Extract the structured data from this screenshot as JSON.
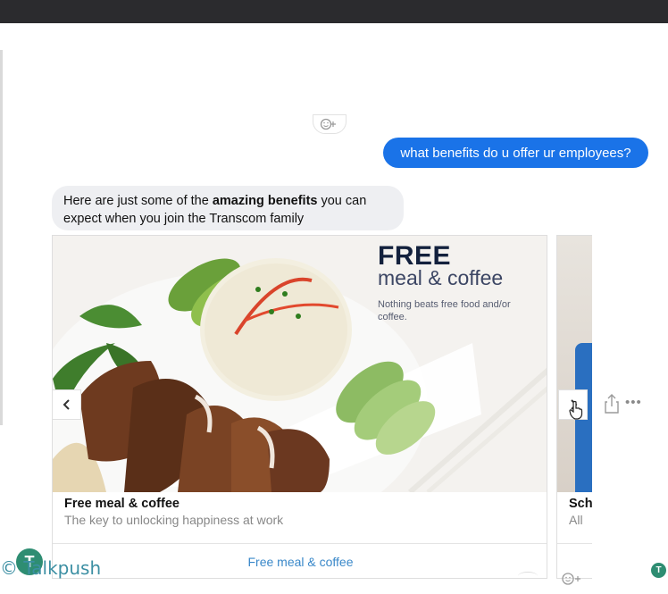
{
  "chat": {
    "outgoing_message": "what benefits do u offer ur employees?",
    "incoming_parts": {
      "before": "Here are just some of the ",
      "bold": "amazing benefits",
      "after": " you can expect when you join the Transcom family"
    }
  },
  "carousel": {
    "cards": [
      {
        "promo_big": "FREE",
        "promo_sub": "meal & coffee",
        "promo_small": "Nothing beats free food and/or coffee.",
        "title": "Free meal & coffee",
        "subtitle": "The key to unlocking happiness at work",
        "button_label": "Free meal & coffee"
      },
      {
        "title": "Sch",
        "subtitle": "All"
      }
    ],
    "prev_icon": "chevron-left-icon",
    "next_icon": "chevron-right-icon"
  },
  "watermark": {
    "logo_letter": "T",
    "text": "© Talkpush"
  },
  "bot_avatar_letter": "T",
  "colors": {
    "outgoing_bubble": "#1a73e8",
    "incoming_bubble": "#eeeff2",
    "button_text": "#3a88c9",
    "brand_green": "#2e8d72"
  }
}
